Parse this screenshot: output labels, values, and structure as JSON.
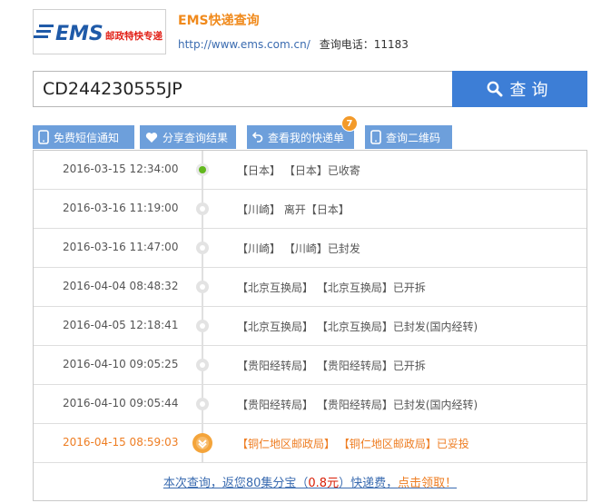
{
  "header": {
    "logo_text": "EMS",
    "logo_subtext": "邮政特快专递",
    "title": "EMS快递查询",
    "website": "http://www.ems.com.cn/",
    "phone_label": "查询电话：11183"
  },
  "search": {
    "value": "CD244230555JP",
    "button_label": "查询"
  },
  "tabs": [
    {
      "label": "免费短信通知",
      "icon": "phone-icon"
    },
    {
      "label": "分享查询结果",
      "icon": "heart-icon"
    },
    {
      "label": "查看我的快递单",
      "icon": "back-arrow-icon"
    },
    {
      "label": "查询二维码",
      "icon": "phone-icon"
    }
  ],
  "badge_count": "7",
  "tracking": [
    {
      "time": "2016-03-15 12:34:00",
      "desc": "【日本】 【日本】已收寄"
    },
    {
      "time": "2016-03-16 11:19:00",
      "desc": "【川崎】 离开【日本】"
    },
    {
      "time": "2016-03-16 11:47:00",
      "desc": "【川崎】 【川崎】已封发"
    },
    {
      "time": "2016-04-04 08:48:32",
      "desc": "【北京互换局】 【北京互换局】已开拆"
    },
    {
      "time": "2016-04-05 12:18:41",
      "desc": "【北京互换局】 【北京互换局】已封发(国内经转)"
    },
    {
      "time": "2016-04-10 09:05:25",
      "desc": "【贵阳经转局】 【贵阳经转局】已开拆"
    },
    {
      "time": "2016-04-10 09:05:44",
      "desc": "【贵阳经转局】 【贵阳经转局】已封发(国内经转)"
    },
    {
      "time": "2016-04-15 08:59:03",
      "desc": "【铜仁地区邮政局】 【铜仁地区邮政局】已妥投"
    }
  ],
  "promo": {
    "prefix": "本次查询，返您80集分宝（",
    "amount": "0.8元",
    "middle": "）快递费，",
    "cta": "点击领取！"
  },
  "colors": {
    "accent_blue": "#3d7ed6",
    "tab_blue": "#6d9fdb",
    "orange": "#f08a1c",
    "delivered_green": "#62b81e"
  }
}
